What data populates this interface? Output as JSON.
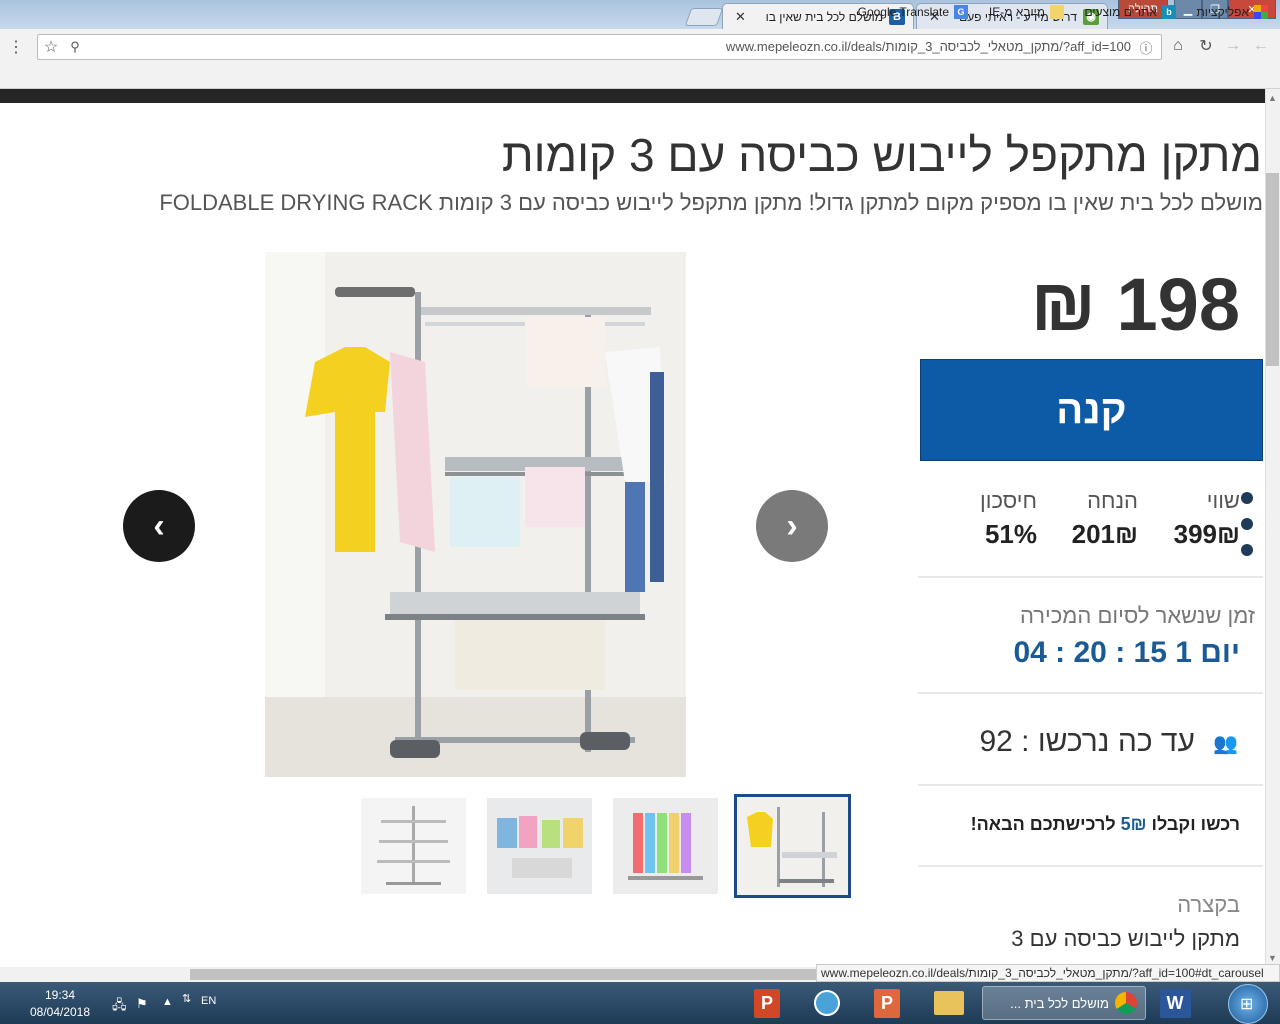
{
  "browser": {
    "tabs": [
      {
        "label": "מושלם לכל בית שאין בו",
        "active": true
      },
      {
        "label": "דרוש מידע - ראיתי פעם",
        "active": false
      }
    ],
    "window_button_help": "תהילה",
    "url": "www.mepeleozn.co.il/deals/מתקן_מטאלי_לכביסה_3_קומות/?aff_id=100",
    "bookmarks": [
      "אפליקציות",
      "אתרים מוצעים",
      "מיובא מ-IE",
      "Google Translate"
    ],
    "status_url": "www.mepeleozn.co.il/deals/מתקן_מטאלי_לכביסה_3_קומות/?aff_id=100#dt_carousel"
  },
  "product": {
    "title": "מתקן מתקפל לייבוש כביסה עם 3 קומות",
    "subtitle": "מושלם לכל בית שאין בו מספיק מקום למתקן גדול! מתקן מתקפל לייבוש כביסה עם 3 קומות FOLDABLE DRYING RACK",
    "price": "198 ₪",
    "buy_label": "קנה",
    "stats": {
      "value_label": "שווי",
      "value": "399₪",
      "discount_label": "הנחה",
      "discount": "201₪",
      "saving_label": "חיסכון",
      "saving": "51%"
    },
    "time_label": "זמן שנשאר לסיום המכירה",
    "time_value": "יום 1  15 : 20 : 04",
    "buyers_text": "עד כה נרכשו : 92",
    "reward_pre": "רכשו וקבלו ",
    "reward_amount": "5₪",
    "reward_post": " לרכישתכם הבאה!",
    "summary_label": "בקצרה",
    "summary_text": "מתקן לייבוש כביסה עם 3"
  },
  "taskbar": {
    "time": "19:34",
    "date": "08/04/2018",
    "lang": "EN",
    "active_window": "מושלם לכל בית ..."
  },
  "colors": {
    "buy_button": "#0d5aa7",
    "time_value": "#1a5a95",
    "active_thumb_border": "#1e4a8a"
  }
}
